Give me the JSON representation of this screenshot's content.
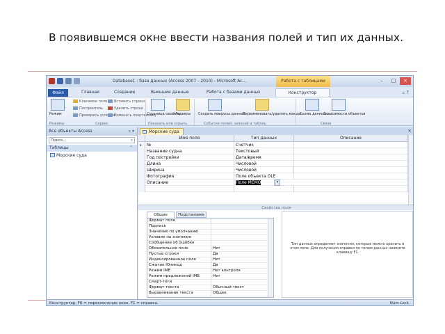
{
  "caption": "В появившемся окне ввести названия полей и тип их данных.",
  "window": {
    "title": "Database1 : база данных (Access 2007 - 2010) - Microsoft Ac...",
    "context_tab": "Работа с таблицами",
    "colors": {
      "file_tab": "#2a5aa8",
      "context": "#f0b94a",
      "selected_type": "#000000",
      "close": "#d9534f"
    }
  },
  "tabs": {
    "file": "Файл",
    "items": [
      "Главная",
      "Создание",
      "Внешние данные",
      "Работа с базами данных"
    ],
    "active": "Конструктор"
  },
  "ribbon": {
    "view_label": "Режим",
    "key_small": [
      "Ключевое поле",
      "Построитель",
      "Проверить условия"
    ],
    "rows_small": [
      "Вставить строки",
      "Удалить строки",
      "Изменить подстановку"
    ],
    "sheet_label": "Страница свойств",
    "index_label": "Индексы",
    "macro_label": "Создать макросы данных",
    "rename_label": "Переименовать/удалить макрос",
    "schema_label": "Схема данных",
    "deps_label": "Зависимости объектов",
    "groups": [
      "Режимы",
      "Сервис",
      "Показать или скрыть",
      "События полей, записей и таблиц",
      "Связи"
    ]
  },
  "nav": {
    "header": "Все объекты Access",
    "search_placeholder": "Поиск...",
    "group": "Таблицы",
    "items": [
      "Морские суда"
    ]
  },
  "document": {
    "tab": "Морские суда",
    "columns": [
      "Имя поля",
      "Тип данных",
      "Описание"
    ],
    "rows": [
      {
        "name": "№",
        "type": "Счетчик"
      },
      {
        "name": "Название судна",
        "type": "Текстовый"
      },
      {
        "name": "Год постройки",
        "type": "Дата/время"
      },
      {
        "name": "Длина",
        "type": "Числовой"
      },
      {
        "name": "Ширина",
        "type": "Числовой"
      },
      {
        "name": "Фотография",
        "type": "Поле объекта OLE"
      },
      {
        "name": "Описание",
        "type": "Поле MEMO"
      }
    ]
  },
  "properties": {
    "title": "Свойства поля",
    "tab_general": "Общие",
    "tab_lookup": "Подстановка",
    "rows": [
      {
        "key": "Формат поля",
        "value": ""
      },
      {
        "key": "Подпись",
        "value": ""
      },
      {
        "key": "Значение по умолчанию",
        "value": ""
      },
      {
        "key": "Условие на значение",
        "value": ""
      },
      {
        "key": "Сообщение об ошибке",
        "value": ""
      },
      {
        "key": "Обязательное поле",
        "value": "Нет"
      },
      {
        "key": "Пустые строки",
        "value": "Да"
      },
      {
        "key": "Индексированное поле",
        "value": "Нет"
      },
      {
        "key": "Сжатие Юникод",
        "value": "Да"
      },
      {
        "key": "Режим IME",
        "value": "Нет контроля"
      },
      {
        "key": "Режим предложений IME",
        "value": "Нет"
      },
      {
        "key": "Смарт-теги",
        "value": ""
      },
      {
        "key": "Формат текста",
        "value": "Обычный текст"
      },
      {
        "key": "Выравнивание текста",
        "value": "Общее"
      }
    ],
    "help": "Тип данных определяет значения, которые можно хранить в этом поле. Для получения справки по типам данных нажмите клавишу F1."
  },
  "status": {
    "left": "Конструктор. F6 = переключение окон. F1 = справка.",
    "right": "Num Lock"
  }
}
